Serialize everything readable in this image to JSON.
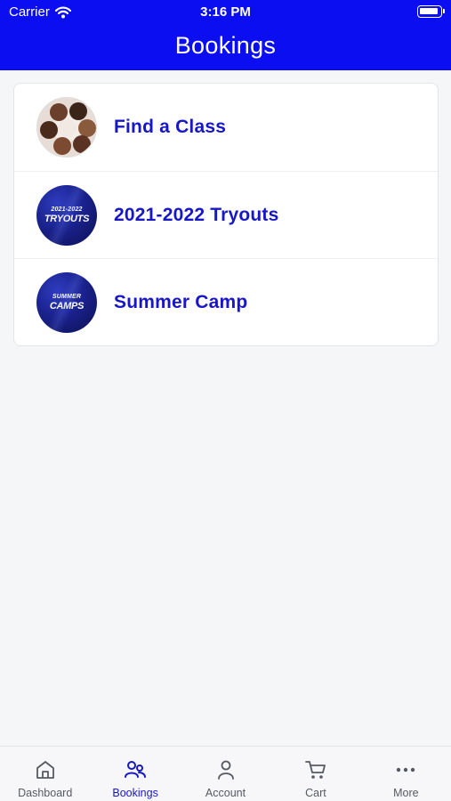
{
  "status_bar": {
    "carrier": "Carrier",
    "time": "3:16 PM"
  },
  "nav": {
    "title": "Bookings"
  },
  "list": {
    "items": [
      {
        "label": "Find a Class"
      },
      {
        "label": "2021-2022 Tryouts",
        "thumb_line1": "2021-2022",
        "thumb_line2": "TRYOUTS"
      },
      {
        "label": "Summer Camp",
        "thumb_line1": "SUMMER",
        "thumb_line2": "CAMPS"
      }
    ]
  },
  "tab_bar": {
    "items": [
      {
        "label": "Dashboard",
        "icon": "home-icon",
        "active": false
      },
      {
        "label": "Bookings",
        "icon": "people-icon",
        "active": true
      },
      {
        "label": "Account",
        "icon": "person-icon",
        "active": false
      },
      {
        "label": "Cart",
        "icon": "cart-icon",
        "active": false
      },
      {
        "label": "More",
        "icon": "more-icon",
        "active": false
      }
    ]
  },
  "colors": {
    "brand_blue": "#0a0ef0",
    "label_blue": "#1717c8",
    "background": "#f5f6f8",
    "tab_inactive": "#555a62"
  }
}
